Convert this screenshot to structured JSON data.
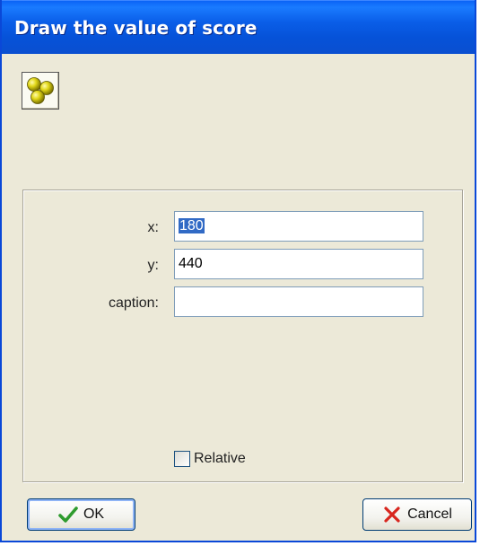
{
  "dialog": {
    "title": "Draw the value of score",
    "action_icon": "draw-score-icon"
  },
  "fields": {
    "x": {
      "label": "x:",
      "value": "180"
    },
    "y": {
      "label": "y:",
      "value": "440"
    },
    "caption": {
      "label": "caption:",
      "value": ""
    }
  },
  "relative": {
    "label": "Relative",
    "checked": false
  },
  "buttons": {
    "ok_label": "OK",
    "ok_icon": "checkmark-icon",
    "cancel_label": "Cancel",
    "cancel_icon": "x-icon"
  },
  "colors": {
    "title_bar": "#0a5ee8",
    "dialog_bg": "#ece9d8",
    "selection": "#316ac5",
    "ok_check": "#2e9b2e",
    "cancel_x": "#d8261e"
  }
}
